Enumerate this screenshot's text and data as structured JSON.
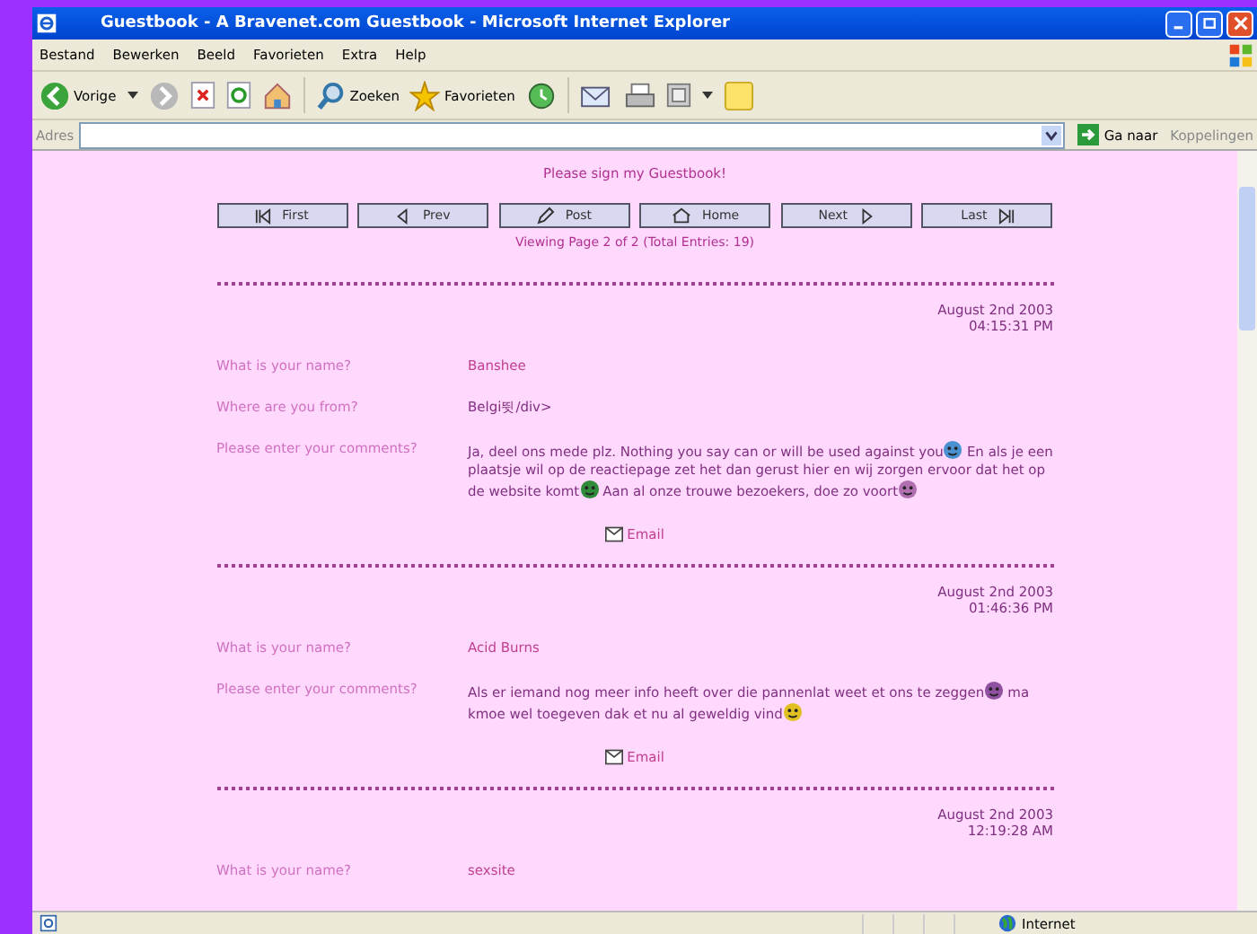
{
  "window": {
    "title": "Guestbook - A Bravenet.com Guestbook - Microsoft Internet Explorer"
  },
  "menu": [
    "Bestand",
    "Bewerken",
    "Beeld",
    "Favorieten",
    "Extra",
    "Help"
  ],
  "toolbar": {
    "back": "Vorige",
    "search": "Zoeken",
    "favorites": "Favorieten"
  },
  "address_bar": {
    "label": "Adres",
    "go": "Ga naar",
    "links": "Koppelingen"
  },
  "page": {
    "heading": "Please sign my Guestbook!",
    "nav": [
      {
        "kind": "first",
        "label": "First"
      },
      {
        "kind": "prev",
        "label": "Prev"
      },
      {
        "kind": "post",
        "label": "Post"
      },
      {
        "kind": "home",
        "label": "Home"
      },
      {
        "kind": "next",
        "label": "Next"
      },
      {
        "kind": "last",
        "label": "Last"
      }
    ],
    "paging": "Viewing Page 2 of 2 (Total Entries: 19)",
    "entries": [
      {
        "date": "August 2nd 2003",
        "time": "04:15:31 PM",
        "fields": [
          {
            "label": "What is your name?",
            "value": "Banshee",
            "kind": "name"
          },
          {
            "label": "Where are you from?",
            "value": "Belgi뜃/div>",
            "kind": "plain"
          }
        ],
        "comment_label": "Please enter your comments?",
        "comment": [
          {
            "kind": "text",
            "text": "Ja, deel ons mede plz. Nothing you say can or will be used against you"
          },
          {
            "kind": "smiley",
            "color": "#4a90d0"
          },
          {
            "kind": "text",
            "text": "En als je een plaatsje wil op de reactiepage zet het dan gerust hier en wij zorgen ervoor dat het op de website komt"
          },
          {
            "kind": "smiley",
            "color": "#2f8a3a"
          },
          {
            "kind": "text",
            "text": "Aan al onze trouwe bezoekers, doe zo voort"
          },
          {
            "kind": "smiley",
            "color": "#b070b0"
          }
        ],
        "email": "Email"
      },
      {
        "date": "August 2nd 2003",
        "time": "01:46:36 PM",
        "fields": [
          {
            "label": "What is your name?",
            "value": "Acid Burns",
            "kind": "name"
          }
        ],
        "comment_label": "Please enter your comments?",
        "comment": [
          {
            "kind": "text",
            "text": "Als er iemand nog meer info heeft over die pannenlat weet et ons te zeggen"
          },
          {
            "kind": "smiley",
            "color": "#9050a0"
          },
          {
            "kind": "text",
            "text": "ma kmoe wel toegeven dak et nu al geweldig vind"
          },
          {
            "kind": "smiley",
            "color": "#e0c020"
          }
        ],
        "email": "Email"
      },
      {
        "date": "August 2nd 2003",
        "time": "12:19:28 AM",
        "fields": [
          {
            "label": "What is your name?",
            "value": "sexsite",
            "kind": "name"
          }
        ]
      }
    ]
  },
  "status_bar": {
    "zone": "Internet"
  }
}
